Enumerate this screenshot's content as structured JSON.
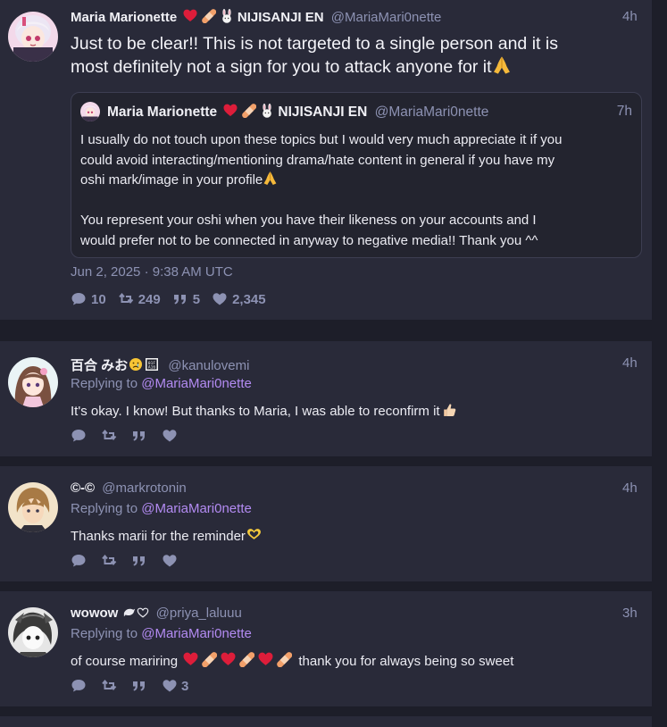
{
  "main_tweet": {
    "display_name": "Maria Marionette",
    "affiliation": "NIJISANJI EN",
    "handle": "@MariaMari0nette",
    "time": "4h",
    "text_line1": "Just to be clear!! This is not targeted to a single person and it is",
    "text_line2": "most definitely not a sign for you to attack anyone for it",
    "quote": {
      "display_name": "Maria Marionette",
      "affiliation": "NIJISANJI EN",
      "handle": "@MariaMari0nette",
      "time": "7h",
      "para1_line1": "I usually do not touch upon these topics but I would very much appreciate it if you",
      "para1_line2": "could avoid interacting/mentioning drama/hate content in general if you have my",
      "para1_line3": "oshi mark/image in your profile",
      "para2_line1": "You represent your oshi when you have their likeness on your accounts and I",
      "para2_line2": "would prefer not to be connected in anyway to negative media!! Thank you ^^"
    },
    "date": "Jun 2, 2025 · 9:38 AM UTC",
    "stats": {
      "replies": "10",
      "retweets": "249",
      "quotes": "5",
      "likes": "2,345"
    }
  },
  "replies": [
    {
      "display_name": "百合 みお",
      "handle": "@kanulovemi",
      "time": "4h",
      "replying_prefix": "Replying to",
      "replying_handle": "@MariaMari0nette",
      "text": "It's okay. I know! But thanks to Maria, I was able to reconfirm it",
      "likes": ""
    },
    {
      "display_name": "©-©",
      "handle": "@markrotonin",
      "time": "4h",
      "replying_prefix": "Replying to",
      "replying_handle": "@MariaMari0nette",
      "text": "Thanks marii for the reminder",
      "likes": ""
    },
    {
      "display_name": "wowow",
      "handle": "@priya_laluuu",
      "time": "3h",
      "replying_prefix": "Replying to",
      "replying_handle": "@MariaMari0nette",
      "text_before": "of course mariring",
      "text_after": "thank you for always being so sweet",
      "likes": "3"
    }
  ],
  "colors": {
    "background": "#1d1e29",
    "card": "#292a39",
    "muted": "#8d92b3",
    "link": "#b38bf2",
    "heart": "#e0193b"
  }
}
